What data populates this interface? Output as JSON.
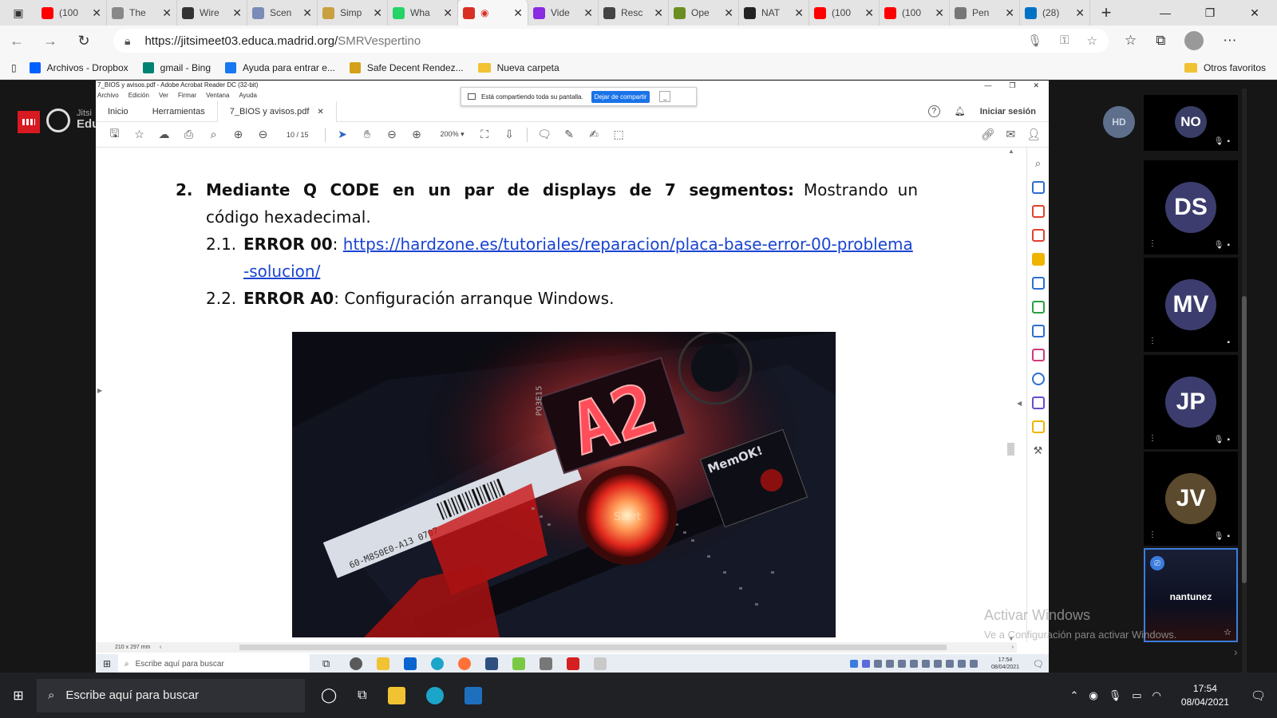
{
  "browser": {
    "tabs": [
      {
        "title": "(100",
        "favicon_color": "#ff0000"
      },
      {
        "title": "The",
        "favicon_color": "#888888"
      },
      {
        "title": "Wire",
        "favicon_color": "#333333"
      },
      {
        "title": "Scen",
        "favicon_color": "#7a8bb8"
      },
      {
        "title": "Simp",
        "favicon_color": "#c8a040"
      },
      {
        "title": "Wha",
        "favicon_color": "#25d366"
      },
      {
        "title": "",
        "favicon_color": "#d93025"
      },
      {
        "title": "Vide",
        "favicon_color": "#8a2be2"
      },
      {
        "title": "Resc",
        "favicon_color": "#444444"
      },
      {
        "title": "Ope",
        "favicon_color": "#6b8e23"
      },
      {
        "title": "NAT",
        "favicon_color": "#222222"
      },
      {
        "title": "(100",
        "favicon_color": "#ff0000"
      },
      {
        "title": "(100",
        "favicon_color": "#ff0000"
      },
      {
        "title": "Pen",
        "favicon_color": "#777777"
      },
      {
        "title": "(28)",
        "favicon_color": "#0072c6"
      }
    ],
    "url_host": "https://jitsimeet03.educa.madrid.org/",
    "url_path": "SMRVespertino",
    "favorites": [
      "Archivos - Dropbox",
      "gmail - Bing",
      "Ayuda para entrar e...",
      "Safe Decent Rendez...",
      "Nueva carpeta"
    ],
    "other_favorites": "Otros favoritos"
  },
  "acrobat": {
    "window_title": "7_BIOS y avisos.pdf - Adobe Acrobat Reader DC (32-bit)",
    "menu": [
      "Archivo",
      "Edición",
      "Ver",
      "Firmar",
      "Ventana",
      "Ayuda"
    ],
    "share_text": "Está compartiendo toda su pantalla.",
    "stop_share": "Dejar de compartir",
    "tabs": {
      "home": "Inicio",
      "tools": "Herramientas",
      "doc": "7_BIOS y avisos.pdf"
    },
    "signin": "Iniciar sesión",
    "page_current": "10",
    "page_total": "/ 15",
    "zoom": "200%",
    "page_size": "210 x 297 mm"
  },
  "document": {
    "item_num": "2.",
    "item_bold": "Mediante Q CODE en un par de displays de 7 segmentos:",
    "item_text": " Mostrando un código hexadecimal.",
    "sub1_num": "2.1.",
    "sub1_bold": "ERROR 00",
    "sub1_sep": ": ",
    "sub1_link": "https://hardzone.es/tutoriales/reparacion/placa-base-error-00-problema-solucion/",
    "sub2_num": "2.2.",
    "sub2_bold": "ERROR A0",
    "sub2_text": ": Configuración arranque Windows."
  },
  "photo": {
    "display_code": "A2",
    "barcode_text": "60-M8S0E0-A13 0707",
    "memok_label": "MemOK!",
    "part_no": "P03E15",
    "button_label": "Start"
  },
  "inner_taskbar": {
    "search": "Escribe aquí para buscar",
    "time": "17:54",
    "date": "08/04/2021"
  },
  "jitsi": {
    "brand_line1": "Jitsi",
    "brand_line2": "Educa",
    "self_badge": "HD",
    "participants": [
      {
        "initials": "NO",
        "color": "#3a3e66"
      },
      {
        "initials": "DS",
        "color": "#3c3d6e"
      },
      {
        "initials": "MV",
        "color": "#3c3d6e"
      },
      {
        "initials": "JP",
        "color": "#3c3d6e"
      },
      {
        "initials": "JV",
        "color": "#5c4a2e"
      }
    ],
    "sharer_name": "nantunez",
    "activate_title": "Activar Windows",
    "activate_sub": "Ve a Configuración para activar Windows."
  },
  "taskbar": {
    "search": "Escribe aquí para buscar",
    "time": "17:54",
    "date": "08/04/2021"
  }
}
